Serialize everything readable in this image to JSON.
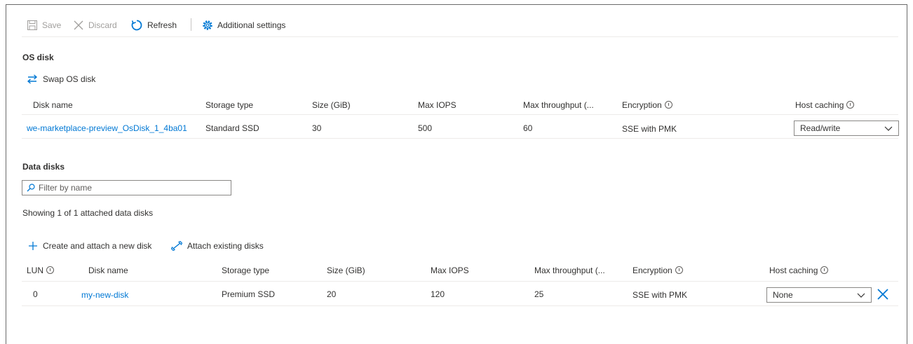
{
  "toolbar": {
    "save": "Save",
    "discard": "Discard",
    "refresh": "Refresh",
    "additional_settings": "Additional settings"
  },
  "os_disk": {
    "title": "OS disk",
    "swap": "Swap OS disk",
    "columns": [
      "Disk name",
      "Storage type",
      "Size (GiB)",
      "Max IOPS",
      "Max throughput (...",
      "Encryption",
      "Host caching"
    ],
    "row": {
      "disk_name": "we-marketplace-preview_OsDisk_1_4ba01",
      "storage_type": "Standard SSD",
      "size": "30",
      "max_iops": "500",
      "max_throughput": "60",
      "encryption": "SSE with PMK",
      "host_caching": "Read/write"
    }
  },
  "data_disks": {
    "title": "Data disks",
    "filter_placeholder": "Filter by name",
    "showing": "Showing 1 of 1 attached data disks",
    "create_attach": "Create and attach a new disk",
    "attach_existing": "Attach existing disks",
    "columns": [
      "LUN",
      "Disk name",
      "Storage type",
      "Size (GiB)",
      "Max IOPS",
      "Max throughput (...",
      "Encryption",
      "Host caching"
    ],
    "rows": [
      {
        "lun": "0",
        "disk_name": "my-new-disk",
        "storage_type": "Premium SSD",
        "size": "20",
        "max_iops": "120",
        "max_throughput": "25",
        "encryption": "SSE with PMK",
        "host_caching": "None"
      }
    ]
  },
  "colors": {
    "link": "#0078d4",
    "disabled": "#a19f9d",
    "text": "#323130"
  },
  "icons": [
    "save-icon",
    "close-icon",
    "refresh-icon",
    "gear-icon",
    "swap-icon",
    "search-icon",
    "plus-icon",
    "attach-icon",
    "chevron-down-icon",
    "info-icon",
    "delete-icon"
  ]
}
